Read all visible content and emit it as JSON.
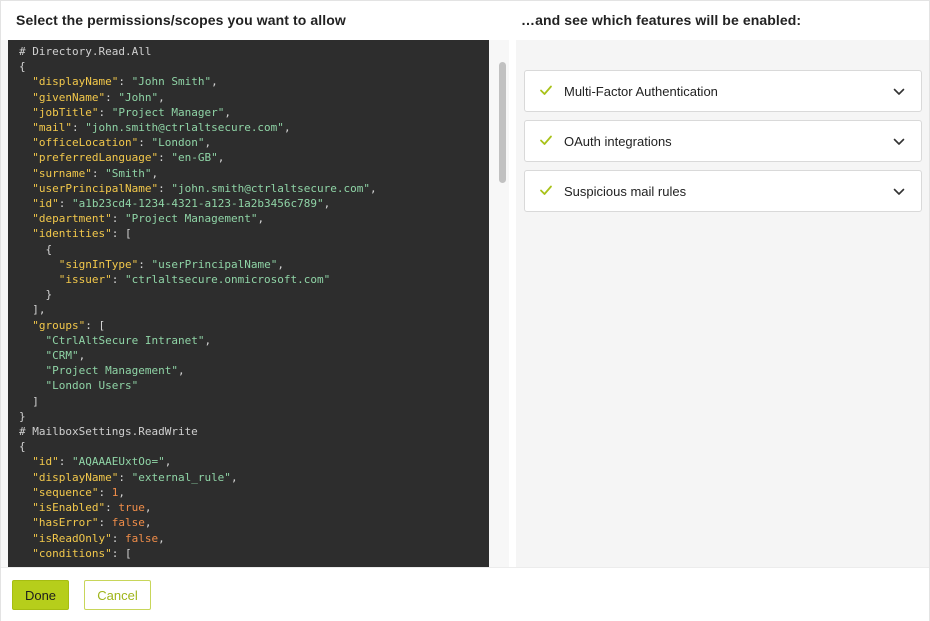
{
  "header": {
    "left_title": "Select the permissions/scopes you want to allow",
    "right_title": "…and see which features will be enabled:"
  },
  "code_panel": {
    "lines": [
      [
        [
          "cm",
          "# Directory.Read.All"
        ]
      ],
      [
        [
          "pun",
          "{"
        ]
      ],
      [
        [
          "pun",
          "  "
        ],
        [
          "key",
          "\"displayName\""
        ],
        [
          "pun",
          ": "
        ],
        [
          "str",
          "\"John Smith\""
        ],
        [
          "pun",
          ","
        ]
      ],
      [
        [
          "pun",
          "  "
        ],
        [
          "key",
          "\"givenName\""
        ],
        [
          "pun",
          ": "
        ],
        [
          "str",
          "\"John\""
        ],
        [
          "pun",
          ","
        ]
      ],
      [
        [
          "pun",
          "  "
        ],
        [
          "key",
          "\"jobTitle\""
        ],
        [
          "pun",
          ": "
        ],
        [
          "str",
          "\"Project Manager\""
        ],
        [
          "pun",
          ","
        ]
      ],
      [
        [
          "pun",
          "  "
        ],
        [
          "key",
          "\"mail\""
        ],
        [
          "pun",
          ": "
        ],
        [
          "str",
          "\"john.smith@ctrlaltsecure.com\""
        ],
        [
          "pun",
          ","
        ]
      ],
      [
        [
          "pun",
          "  "
        ],
        [
          "key",
          "\"officeLocation\""
        ],
        [
          "pun",
          ": "
        ],
        [
          "str",
          "\"London\""
        ],
        [
          "pun",
          ","
        ]
      ],
      [
        [
          "pun",
          "  "
        ],
        [
          "key",
          "\"preferredLanguage\""
        ],
        [
          "pun",
          ": "
        ],
        [
          "str",
          "\"en-GB\""
        ],
        [
          "pun",
          ","
        ]
      ],
      [
        [
          "pun",
          "  "
        ],
        [
          "key",
          "\"surname\""
        ],
        [
          "pun",
          ": "
        ],
        [
          "str",
          "\"Smith\""
        ],
        [
          "pun",
          ","
        ]
      ],
      [
        [
          "pun",
          "  "
        ],
        [
          "key",
          "\"userPrincipalName\""
        ],
        [
          "pun",
          ": "
        ],
        [
          "str",
          "\"john.smith@ctrlaltsecure.com\""
        ],
        [
          "pun",
          ","
        ]
      ],
      [
        [
          "pun",
          "  "
        ],
        [
          "key",
          "\"id\""
        ],
        [
          "pun",
          ": "
        ],
        [
          "str",
          "\"a1b23cd4-1234-4321-a123-1a2b3456c789\""
        ],
        [
          "pun",
          ","
        ]
      ],
      [
        [
          "pun",
          "  "
        ],
        [
          "key",
          "\"department\""
        ],
        [
          "pun",
          ": "
        ],
        [
          "str",
          "\"Project Management\""
        ],
        [
          "pun",
          ","
        ]
      ],
      [
        [
          "pun",
          "  "
        ],
        [
          "key",
          "\"identities\""
        ],
        [
          "pun",
          ": ["
        ]
      ],
      [
        [
          "pun",
          "    {"
        ]
      ],
      [
        [
          "pun",
          "      "
        ],
        [
          "key",
          "\"signInType\""
        ],
        [
          "pun",
          ": "
        ],
        [
          "str",
          "\"userPrincipalName\""
        ],
        [
          "pun",
          ","
        ]
      ],
      [
        [
          "pun",
          "      "
        ],
        [
          "key",
          "\"issuer\""
        ],
        [
          "pun",
          ": "
        ],
        [
          "str",
          "\"ctrlaltsecure.onmicrosoft.com\""
        ]
      ],
      [
        [
          "pun",
          "    }"
        ]
      ],
      [
        [
          "pun",
          "  ],"
        ]
      ],
      [
        [
          "pun",
          "  "
        ],
        [
          "key",
          "\"groups\""
        ],
        [
          "pun",
          ": ["
        ]
      ],
      [
        [
          "pun",
          "    "
        ],
        [
          "str",
          "\"CtrlAltSecure Intranet\""
        ],
        [
          "pun",
          ","
        ]
      ],
      [
        [
          "pun",
          "    "
        ],
        [
          "str",
          "\"CRM\""
        ],
        [
          "pun",
          ","
        ]
      ],
      [
        [
          "pun",
          "    "
        ],
        [
          "str",
          "\"Project Management\""
        ],
        [
          "pun",
          ","
        ]
      ],
      [
        [
          "pun",
          "    "
        ],
        [
          "str",
          "\"London Users\""
        ]
      ],
      [
        [
          "pun",
          "  ]"
        ]
      ],
      [
        [
          "pun",
          "}"
        ]
      ],
      [
        [
          "pun",
          ""
        ]
      ],
      [
        [
          "cm",
          "# MailboxSettings.ReadWrite"
        ]
      ],
      [
        [
          "pun",
          "{"
        ]
      ],
      [
        [
          "pun",
          "  "
        ],
        [
          "key",
          "\"id\""
        ],
        [
          "pun",
          ": "
        ],
        [
          "str",
          "\"AQAAAEUxtOo=\""
        ],
        [
          "pun",
          ","
        ]
      ],
      [
        [
          "pun",
          "  "
        ],
        [
          "key",
          "\"displayName\""
        ],
        [
          "pun",
          ": "
        ],
        [
          "str",
          "\"external_rule\""
        ],
        [
          "pun",
          ","
        ]
      ],
      [
        [
          "pun",
          "  "
        ],
        [
          "key",
          "\"sequence\""
        ],
        [
          "pun",
          ": "
        ],
        [
          "num",
          "1"
        ],
        [
          "pun",
          ","
        ]
      ],
      [
        [
          "pun",
          "  "
        ],
        [
          "key",
          "\"isEnabled\""
        ],
        [
          "pun",
          ": "
        ],
        [
          "bool",
          "true"
        ],
        [
          "pun",
          ","
        ]
      ],
      [
        [
          "pun",
          "  "
        ],
        [
          "key",
          "\"hasError\""
        ],
        [
          "pun",
          ": "
        ],
        [
          "bool",
          "false"
        ],
        [
          "pun",
          ","
        ]
      ],
      [
        [
          "pun",
          "  "
        ],
        [
          "key",
          "\"isReadOnly\""
        ],
        [
          "pun",
          ": "
        ],
        [
          "bool",
          "false"
        ],
        [
          "pun",
          ","
        ]
      ],
      [
        [
          "pun",
          "  "
        ],
        [
          "key",
          "\"conditions\""
        ],
        [
          "pun",
          ": ["
        ]
      ]
    ]
  },
  "features": [
    {
      "label": "Multi-Factor Authentication",
      "enabled": true,
      "icon": "check-icon",
      "expand_icon": "chevron-down-icon"
    },
    {
      "label": "OAuth integrations",
      "enabled": true,
      "icon": "check-icon",
      "expand_icon": "chevron-down-icon"
    },
    {
      "label": "Suspicious mail rules",
      "enabled": true,
      "icon": "check-icon",
      "expand_icon": "chevron-down-icon"
    }
  ],
  "footer": {
    "done_label": "Done",
    "cancel_label": "Cancel"
  },
  "colors": {
    "accent": "#b6ce1b",
    "check": "#a9c21a",
    "code_background": "#2d2d2d",
    "json_key": "#f2c84b",
    "json_string": "#8fd4a6",
    "json_literal": "#f08d49"
  }
}
